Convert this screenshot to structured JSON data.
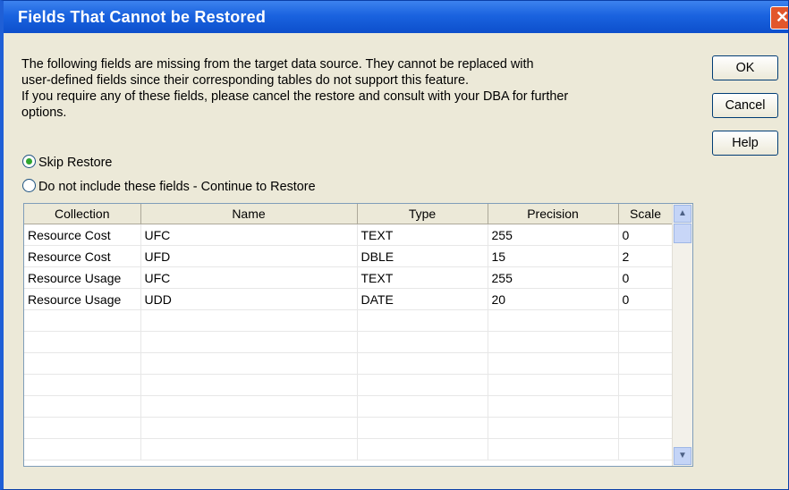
{
  "window": {
    "title": "Fields That Cannot be Restored"
  },
  "message": {
    "line1": "The following fields are missing from the target data source.  They cannot be replaced with",
    "line2": "user-defined fields since their corresponding tables do not support this feature.",
    "line3": "If you require any of these fields, please cancel the restore and consult with your DBA for further",
    "line4": "options."
  },
  "buttons": {
    "ok": "OK",
    "cancel": "Cancel",
    "help": "Help"
  },
  "radios": {
    "skip": "Skip Restore",
    "continue": "Do not include these fields - Continue to Restore",
    "selected": "skip"
  },
  "grid": {
    "headers": [
      "Collection",
      "Name",
      "Type",
      "Precision",
      "Scale"
    ],
    "rows": [
      [
        "Resource Cost",
        "UFC",
        "TEXT",
        "255",
        "0"
      ],
      [
        "Resource Cost",
        "UFD",
        "DBLE",
        "15",
        "2"
      ],
      [
        "Resource Usage",
        "UFC",
        "TEXT",
        "255",
        "0"
      ],
      [
        "Resource Usage",
        "UDD",
        "DATE",
        "20",
        "0"
      ]
    ]
  },
  "icons": {
    "close": "close-icon",
    "scroll_up": "scroll-up-arrow-icon",
    "scroll_down": "scroll-down-arrow-icon"
  }
}
